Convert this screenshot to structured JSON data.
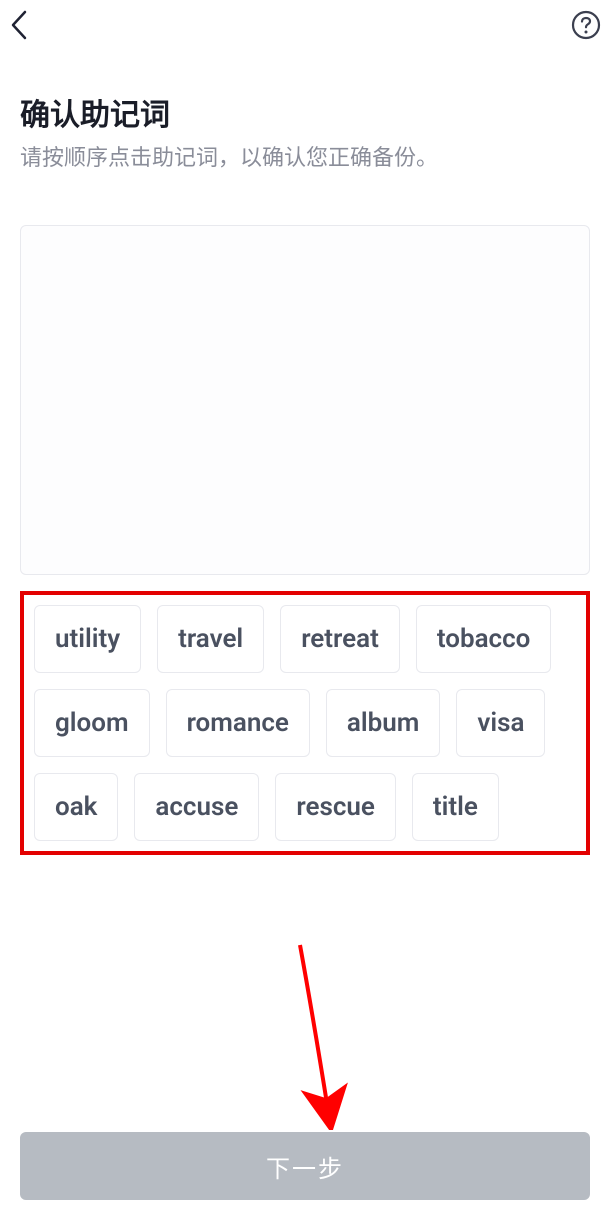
{
  "header": {
    "back_icon": "back-chevron",
    "help_icon": "help-question"
  },
  "page": {
    "title": "确认助记词",
    "subtitle": "请按顺序点击助记词，以确认您正确备份。"
  },
  "words": [
    "utility",
    "travel",
    "retreat",
    "tobacco",
    "gloom",
    "romance",
    "album",
    "visa",
    "oak",
    "accuse",
    "rescue",
    "title"
  ],
  "footer": {
    "next_label": "下一步"
  },
  "annotations": {
    "highlight_color": "#e30000",
    "arrow_color": "#ff0000"
  }
}
